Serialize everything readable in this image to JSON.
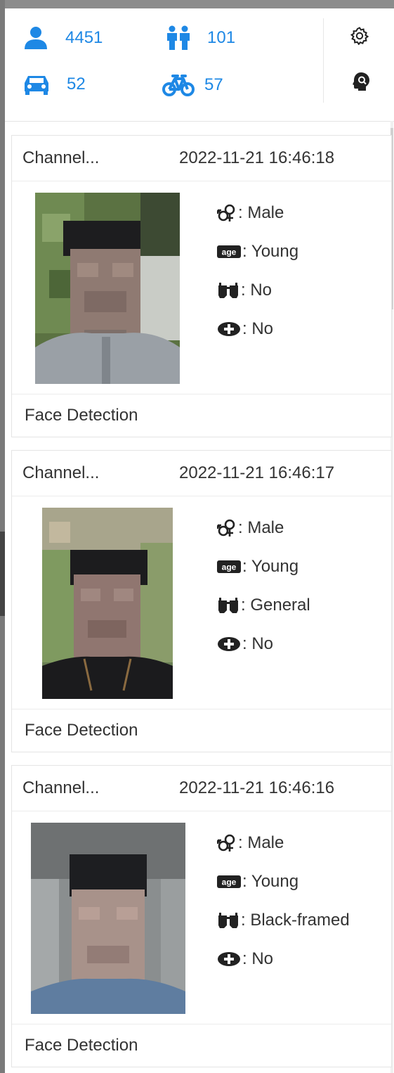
{
  "stats": {
    "person_count": "4451",
    "crowd_count": "101",
    "vehicle_count": "52",
    "bike_count": "57"
  },
  "cards": [
    {
      "channel": "Channel...",
      "timestamp": "2022-11-21 16:46:18",
      "gender": ": Male",
      "age": ": Young",
      "glasses": ": No",
      "mask": ": No",
      "footer": "Face Detection"
    },
    {
      "channel": "Channel...",
      "timestamp": "2022-11-21 16:46:17",
      "gender": ": Male",
      "age": ": Young",
      "glasses": ": General",
      "mask": ": No",
      "footer": "Face Detection"
    },
    {
      "channel": "Channel...",
      "timestamp": "2022-11-21 16:46:16",
      "gender": ": Male",
      "age": ": Young",
      "glasses": ": Black-framed",
      "mask": ": No",
      "footer": "Face Detection"
    }
  ],
  "colors": {
    "accent": "#1e88e5",
    "text": "#333333",
    "border": "#e4e4e4"
  },
  "icons": {
    "person": "person-icon",
    "crowd": "crowd-icon",
    "vehicle": "car-icon",
    "bike": "bicycle-icon",
    "settings": "gear-icon",
    "face_search": "face-search-icon",
    "gender": "gender-icon",
    "age": "age-icon",
    "glasses": "glasses-icon",
    "mask": "mask-icon",
    "collapse": "chevron-right-icon"
  }
}
